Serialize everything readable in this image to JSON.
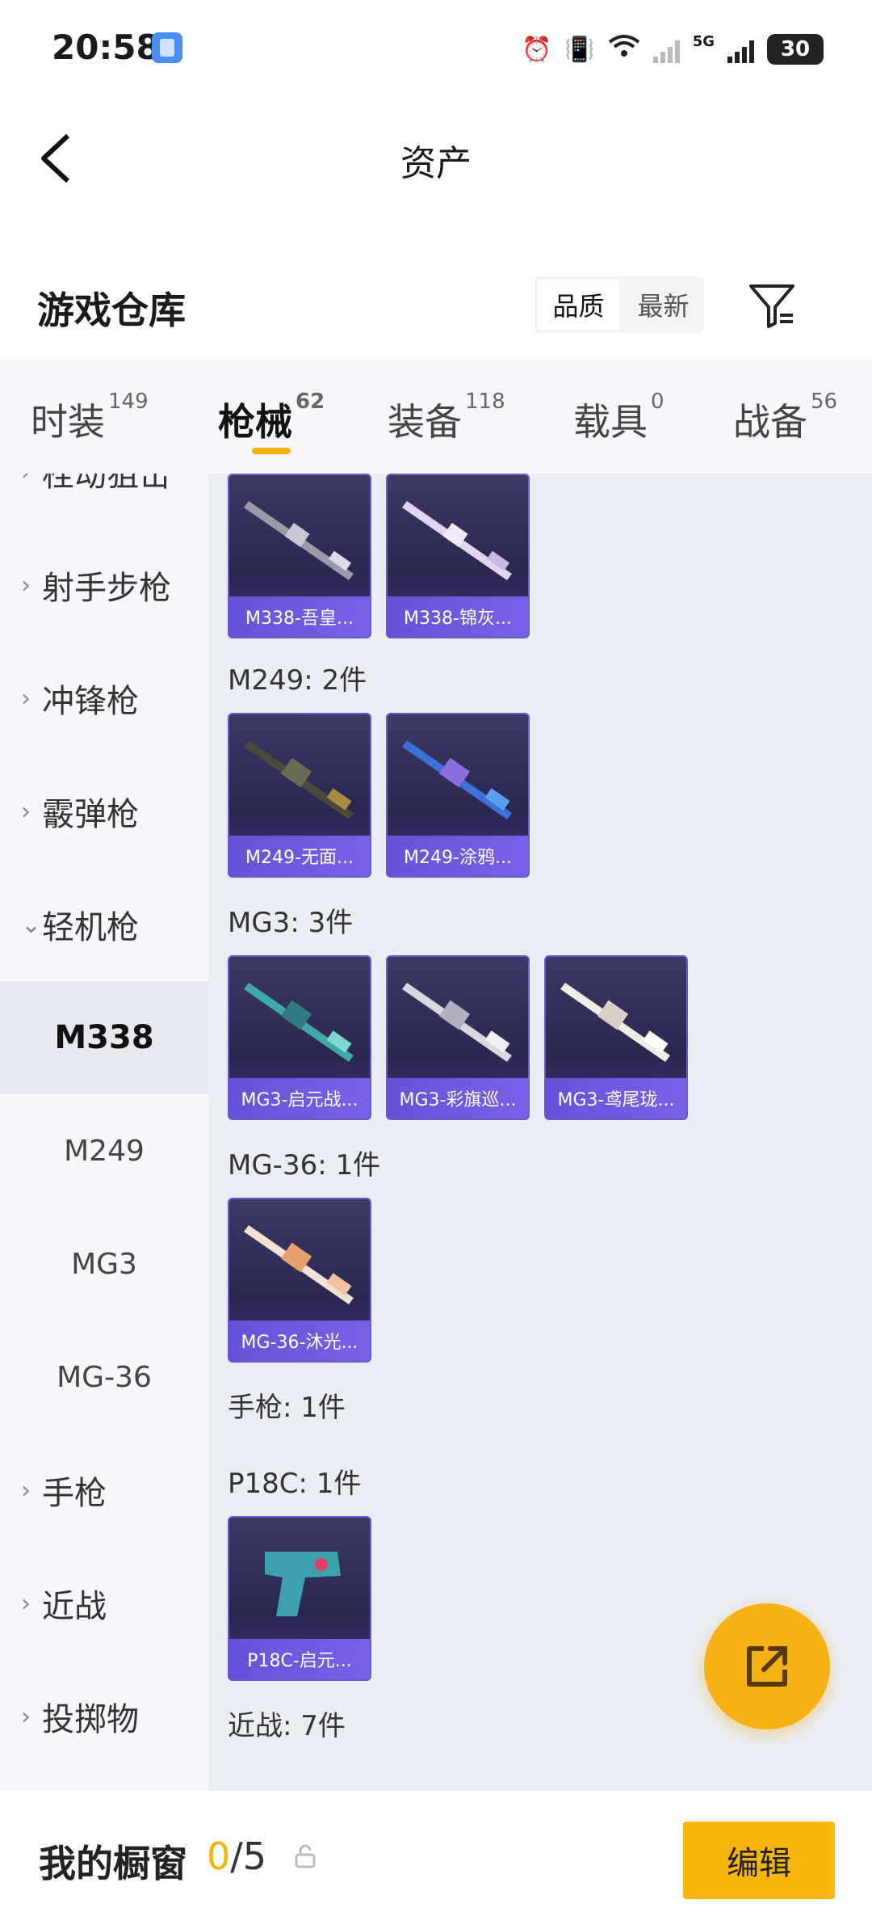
{
  "status_bar": {
    "time": "20:58",
    "network": "5G",
    "battery": "30"
  },
  "nav": {
    "title": "资产"
  },
  "section": {
    "title": "游戏仓库",
    "sort_options": [
      "品质",
      "最新"
    ],
    "active_sort": "品质"
  },
  "tabs": [
    {
      "label": "时装",
      "count": "149"
    },
    {
      "label": "枪械",
      "count": "62",
      "active": true
    },
    {
      "label": "装备",
      "count": "118"
    },
    {
      "label": "载具",
      "count": "0"
    },
    {
      "label": "战备",
      "count": "56"
    }
  ],
  "sidebar": {
    "categories": [
      "栓动狙击",
      "射手步枪",
      "冲锋枪",
      "霰弹枪",
      "轻机枪"
    ],
    "subitems": [
      "M338",
      "M249",
      "MG3",
      "MG-36"
    ],
    "categories_after": [
      "手枪",
      "近战",
      "投掷物"
    ],
    "active_subitem": "M338"
  },
  "content": {
    "groups": [
      {
        "label": "",
        "items": [
          "M338-吾皇...",
          "M338-锦灰..."
        ]
      },
      {
        "label": "M249: 2件",
        "items": [
          "M249-无面...",
          "M249-涂鸦..."
        ]
      },
      {
        "label": "MG3: 3件",
        "items": [
          "MG3-启元战...",
          "MG3-彩旗巡...",
          "MG3-鸢尾珑..."
        ]
      },
      {
        "label": "MG-36: 1件",
        "items": [
          "MG-36-沐光..."
        ]
      },
      {
        "label": "手枪: 1件",
        "items": []
      },
      {
        "label": "P18C: 1件",
        "items": [
          "P18C-启元..."
        ]
      },
      {
        "label": "近战: 7件",
        "items": []
      }
    ]
  },
  "bottom_bar": {
    "title": "我的橱窗",
    "current": "0",
    "total": "/5",
    "edit_label": "编辑"
  },
  "colors": {
    "accent": "#f5b300",
    "card_caption": "#6652d6"
  }
}
